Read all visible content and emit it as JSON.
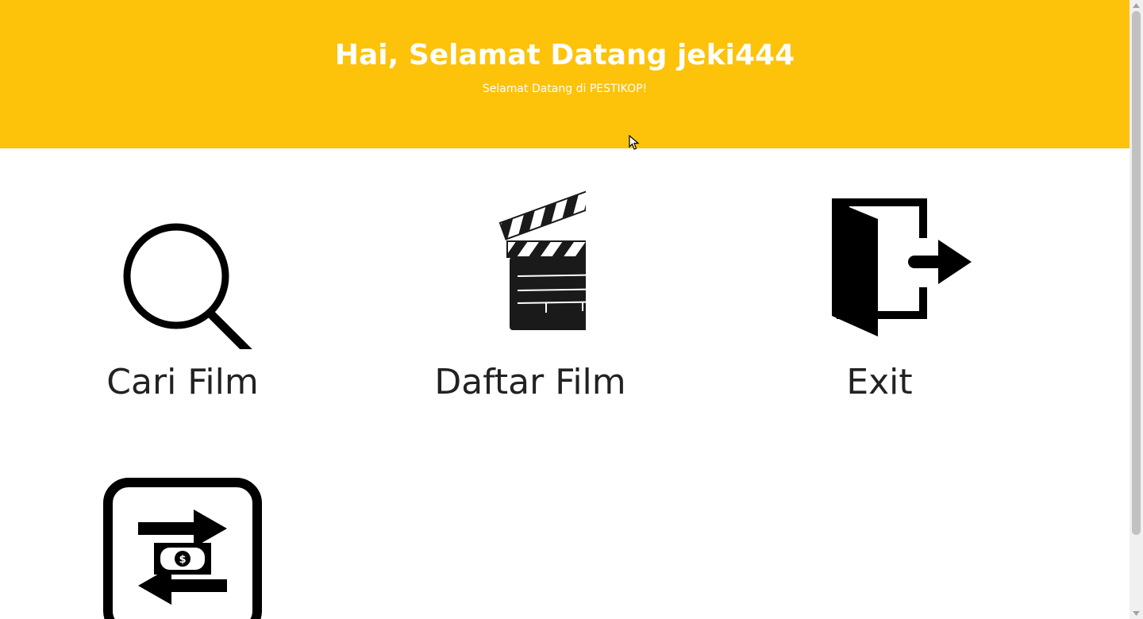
{
  "hero": {
    "title": "Hai, Selamat Datang jeki444",
    "subtitle": "Selamat Datang di PESTIKOP!",
    "background_color": "#fdc20a"
  },
  "menu": [
    {
      "label": "Cari Film",
      "icon": "search-icon"
    },
    {
      "label": "Daftar Film",
      "icon": "clapperboard-icon"
    },
    {
      "label": "Exit",
      "icon": "exit-door-icon"
    },
    {
      "label": "",
      "icon": "money-transfer-icon"
    }
  ]
}
